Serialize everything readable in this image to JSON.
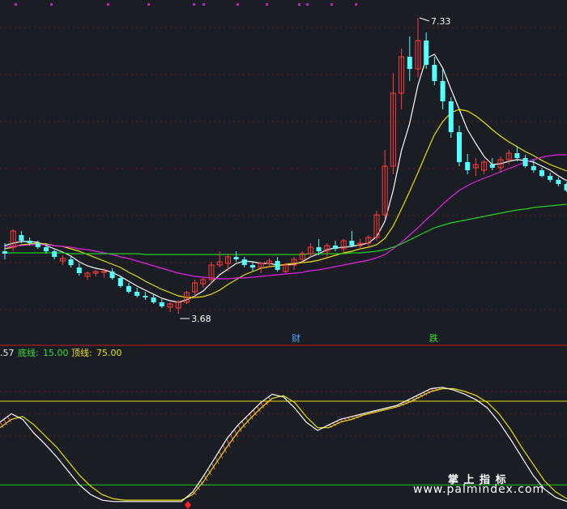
{
  "price_panel": {
    "high_label": "7.33",
    "low_label": "3.68",
    "marker_cai": "财",
    "marker_die": "跌"
  },
  "indicator_panel": {
    "legend": {
      "value_text": ".57",
      "bottom_label": "底线:",
      "bottom_value": "15.00",
      "top_label": "顶线:",
      "top_value": "75.00"
    },
    "bottom_line_value": 15,
    "top_line_value": 75
  },
  "watermark": {
    "title": "掌 上 指 标",
    "url": "www.palmindex.com"
  },
  "colors": {
    "background": "#1b1d24",
    "up_candle": "#ff3b3b",
    "down_candle": "#54ffff",
    "ma_white": "#ffffff",
    "ma_yellow": "#e8e000",
    "ma_magenta": "#e020e0",
    "ma_green": "#20d020",
    "top_line": "#e8e000",
    "bottom_line": "#20d020",
    "grid": "#5a1a1a"
  },
  "chart_data": [
    {
      "type": "candlestick",
      "title": "",
      "price_range": [
        3.68,
        7.33
      ],
      "annotations": [
        "7.33",
        "3.68",
        "财",
        "跌"
      ],
      "ohlc": [
        [
          4.45,
          4.55,
          4.35,
          4.42
        ],
        [
          4.5,
          4.72,
          4.45,
          4.7
        ],
        [
          4.65,
          4.7,
          4.55,
          4.58
        ],
        [
          4.58,
          4.62,
          4.52,
          4.55
        ],
        [
          4.55,
          4.58,
          4.48,
          4.5
        ],
        [
          4.5,
          4.55,
          4.42,
          4.45
        ],
        [
          4.45,
          4.48,
          4.35,
          4.38
        ],
        [
          4.33,
          4.4,
          4.28,
          4.36
        ],
        [
          4.35,
          4.38,
          4.25,
          4.28
        ],
        [
          4.25,
          4.3,
          4.15,
          4.18
        ],
        [
          4.14,
          4.2,
          4.1,
          4.18
        ],
        [
          4.18,
          4.22,
          4.14,
          4.2
        ],
        [
          4.19,
          4.24,
          4.12,
          4.2
        ],
        [
          4.2,
          4.24,
          4.1,
          4.12
        ],
        [
          4.12,
          4.15,
          4.0,
          4.02
        ],
        [
          4.02,
          4.06,
          3.93,
          3.95
        ],
        [
          3.95,
          4.0,
          3.88,
          3.9
        ],
        [
          3.9,
          3.95,
          3.85,
          3.88
        ],
        [
          3.88,
          3.92,
          3.8,
          3.82
        ],
        [
          3.82,
          3.86,
          3.75,
          3.77
        ],
        [
          3.76,
          3.82,
          3.7,
          3.8
        ],
        [
          3.75,
          3.85,
          3.68,
          3.82
        ],
        [
          3.82,
          3.96,
          3.8,
          3.94
        ],
        [
          3.95,
          4.1,
          3.88,
          4.06
        ],
        [
          4.05,
          4.12,
          4.0,
          4.1
        ],
        [
          4.1,
          4.32,
          4.05,
          4.28
        ],
        [
          4.28,
          4.45,
          4.25,
          4.32
        ],
        [
          4.3,
          4.42,
          4.2,
          4.38
        ],
        [
          4.38,
          4.45,
          4.32,
          4.35
        ],
        [
          4.35,
          4.38,
          4.25,
          4.28
        ],
        [
          4.28,
          4.32,
          4.2,
          4.25
        ],
        [
          4.25,
          4.32,
          4.18,
          4.3
        ],
        [
          4.3,
          4.36,
          4.25,
          4.33
        ],
        [
          4.33,
          4.38,
          4.2,
          4.22
        ],
        [
          4.2,
          4.3,
          4.18,
          4.28
        ],
        [
          4.28,
          4.38,
          4.22,
          4.35
        ],
        [
          4.35,
          4.45,
          4.3,
          4.42
        ],
        [
          4.42,
          4.55,
          4.38,
          4.5
        ],
        [
          4.5,
          4.6,
          4.4,
          4.45
        ],
        [
          4.45,
          4.55,
          4.35,
          4.52
        ],
        [
          4.52,
          4.58,
          4.45,
          4.48
        ],
        [
          4.48,
          4.6,
          4.42,
          4.58
        ],
        [
          4.58,
          4.7,
          4.5,
          4.52
        ],
        [
          4.52,
          4.6,
          4.48,
          4.55
        ],
        [
          4.55,
          4.65,
          4.5,
          4.62
        ],
        [
          4.62,
          4.95,
          4.58,
          4.9
        ],
        [
          4.9,
          5.7,
          4.85,
          5.5
        ],
        [
          5.5,
          6.65,
          5.4,
          6.4
        ],
        [
          6.4,
          6.95,
          6.2,
          6.85
        ],
        [
          6.85,
          7.1,
          6.55,
          6.7
        ],
        [
          6.7,
          7.33,
          6.6,
          7.05
        ],
        [
          7.05,
          7.15,
          6.7,
          6.75
        ],
        [
          6.75,
          6.85,
          6.5,
          6.55
        ],
        [
          6.55,
          6.7,
          6.2,
          6.3
        ],
        [
          6.3,
          6.35,
          5.85,
          5.92
        ],
        [
          5.92,
          6.0,
          5.5,
          5.55
        ],
        [
          5.55,
          5.65,
          5.4,
          5.45
        ],
        [
          5.48,
          5.6,
          5.38,
          5.52
        ],
        [
          5.45,
          5.58,
          5.4,
          5.55
        ],
        [
          5.52,
          5.6,
          5.45,
          5.48
        ],
        [
          5.48,
          5.62,
          5.42,
          5.58
        ],
        [
          5.58,
          5.7,
          5.52,
          5.66
        ],
        [
          5.66,
          5.75,
          5.56,
          5.6
        ],
        [
          5.6,
          5.64,
          5.48,
          5.5
        ],
        [
          5.5,
          5.58,
          5.42,
          5.45
        ],
        [
          5.45,
          5.48,
          5.36,
          5.38
        ],
        [
          5.38,
          5.42,
          5.3,
          5.33
        ],
        [
          5.33,
          5.36,
          5.25,
          5.28
        ],
        [
          5.28,
          5.3,
          5.18,
          5.2
        ]
      ],
      "ma_series": [
        {
          "values": [
            4.52,
            4.55,
            4.57,
            4.57,
            4.56,
            4.52,
            4.48,
            4.44,
            4.39,
            4.32,
            4.27,
            4.24,
            4.22,
            4.19,
            4.14,
            4.08,
            4.02,
            3.97,
            3.92,
            3.87,
            3.84,
            3.82,
            3.85,
            3.9,
            3.96,
            4.06,
            4.16,
            4.23,
            4.3,
            4.33,
            4.32,
            4.3,
            4.3,
            4.28,
            4.28,
            4.29,
            4.32,
            4.38,
            4.42,
            4.47,
            4.49,
            4.5,
            4.51,
            4.53,
            4.55,
            4.63,
            4.82,
            5.2,
            5.69,
            6.03,
            6.5,
            6.83,
            6.88,
            6.71,
            6.45,
            6.2,
            5.95,
            5.78,
            5.62,
            5.52,
            5.53,
            5.56,
            5.58,
            5.57,
            5.55,
            5.5,
            5.45,
            5.38,
            5.32
          ]
        },
        {
          "values": [
            4.48,
            4.5,
            4.53,
            4.54,
            4.55,
            4.54,
            4.52,
            4.51,
            4.48,
            4.45,
            4.41,
            4.37,
            4.33,
            4.29,
            4.25,
            4.19,
            4.14,
            4.08,
            4.03,
            3.98,
            3.94,
            3.9,
            3.88,
            3.88,
            3.89,
            3.92,
            3.97,
            4.04,
            4.1,
            4.16,
            4.2,
            4.24,
            4.26,
            4.27,
            4.29,
            4.3,
            4.31,
            4.32,
            4.34,
            4.37,
            4.4,
            4.43,
            4.45,
            4.48,
            4.5,
            4.53,
            4.61,
            4.76,
            4.97,
            5.19,
            5.42,
            5.66,
            5.89,
            6.05,
            6.16,
            6.2,
            6.18,
            6.12,
            6.04,
            5.95,
            5.87,
            5.8,
            5.74,
            5.68,
            5.63,
            5.57,
            5.52,
            5.48,
            5.44
          ]
        },
        {
          "values": [
            4.5,
            4.51,
            4.52,
            4.53,
            4.53,
            4.53,
            4.52,
            4.51,
            4.5,
            4.48,
            4.47,
            4.45,
            4.43,
            4.41,
            4.38,
            4.36,
            4.33,
            4.3,
            4.27,
            4.24,
            4.21,
            4.18,
            4.16,
            4.14,
            4.13,
            4.12,
            4.11,
            4.11,
            4.12,
            4.12,
            4.13,
            4.14,
            4.15,
            4.16,
            4.17,
            4.18,
            4.19,
            4.21,
            4.22,
            4.24,
            4.26,
            4.28,
            4.3,
            4.32,
            4.34,
            4.37,
            4.41,
            4.48,
            4.56,
            4.65,
            4.74,
            4.84,
            4.93,
            5.03,
            5.12,
            5.2,
            5.26,
            5.31,
            5.35,
            5.39,
            5.43,
            5.47,
            5.51,
            5.55,
            5.58,
            5.61,
            5.63,
            5.64,
            5.64
          ]
        },
        {
          "values": [
            4.43,
            4.43,
            4.43,
            4.43,
            4.43,
            4.43,
            4.43,
            4.43,
            4.42,
            4.42,
            4.42,
            4.42,
            4.42,
            4.42,
            4.42,
            4.42,
            4.42,
            4.41,
            4.41,
            4.41,
            4.41,
            4.41,
            4.41,
            4.41,
            4.41,
            4.41,
            4.41,
            4.41,
            4.41,
            4.41,
            4.41,
            4.41,
            4.41,
            4.41,
            4.41,
            4.41,
            4.41,
            4.42,
            4.42,
            4.42,
            4.42,
            4.42,
            4.43,
            4.43,
            4.44,
            4.45,
            4.47,
            4.5,
            4.54,
            4.59,
            4.64,
            4.69,
            4.74,
            4.77,
            4.8,
            4.82,
            4.84,
            4.86,
            4.88,
            4.9,
            4.92,
            4.94,
            4.96,
            4.97,
            4.99,
            5.0,
            5.01,
            5.02,
            5.03
          ]
        }
      ]
    },
    {
      "type": "line",
      "title": "",
      "ylim": [
        0,
        100
      ],
      "reference_lines": [
        15,
        75
      ],
      "series": [
        {
          "values": [
            60,
            66,
            62,
            52,
            44,
            35,
            25,
            15,
            8,
            4,
            3,
            3,
            3,
            3,
            3,
            3,
            3,
            10,
            22,
            35,
            48,
            58,
            66,
            74,
            80,
            78,
            70,
            60,
            54,
            58,
            62,
            64,
            66,
            68,
            70,
            72,
            76,
            80,
            84,
            85,
            83,
            80,
            76,
            70,
            60,
            48,
            35,
            22,
            12,
            6,
            3
          ]
        },
        {
          "values": [
            56,
            62,
            64,
            58,
            50,
            42,
            32,
            22,
            14,
            8,
            5,
            4,
            4,
            4,
            4,
            4,
            4,
            8,
            18,
            30,
            42,
            53,
            62,
            70,
            77,
            79,
            74,
            64,
            56,
            56,
            60,
            62,
            65,
            67,
            69,
            71,
            74,
            78,
            82,
            84,
            84,
            82,
            79,
            74,
            66,
            55,
            42,
            30,
            18,
            10,
            5
          ]
        }
      ]
    }
  ]
}
